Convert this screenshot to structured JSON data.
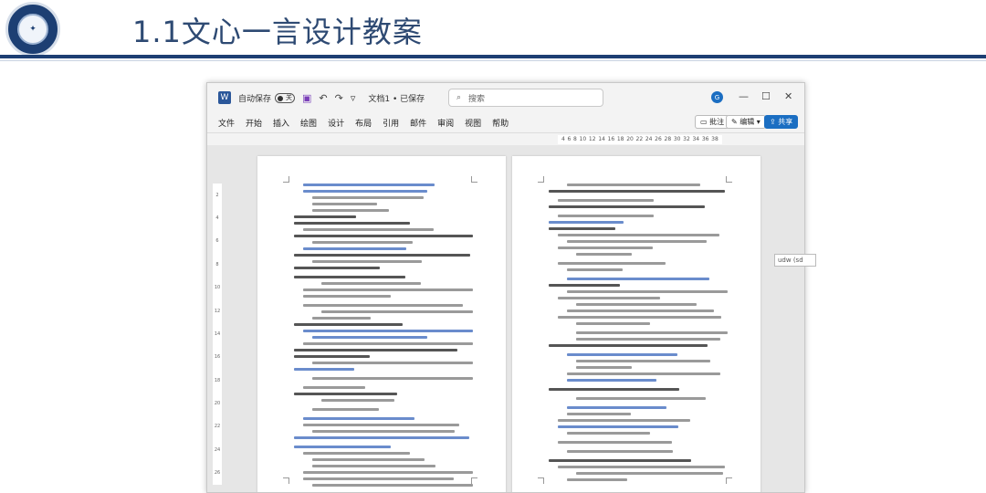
{
  "slide": {
    "title": "1.1文心一言设计教案"
  },
  "window": {
    "autosave_label": "自动保存",
    "autosave_state": "关",
    "doc_title": "文档1 • 已保存",
    "search_placeholder": "搜索",
    "avatar_initial": "G",
    "menu": [
      "文件",
      "开始",
      "插入",
      "绘图",
      "设计",
      "布局",
      "引用",
      "邮件",
      "审阅",
      "视图",
      "帮助"
    ],
    "comment_label": "批注",
    "edit_label": "编辑",
    "share_label": "共享",
    "ruler_ticks": [
      "4",
      "6",
      "8",
      "10",
      "12",
      "14",
      "16",
      "18",
      "20",
      "22",
      "24",
      "26",
      "28",
      "30",
      "32",
      "34",
      "36",
      "38"
    ],
    "vruler_ticks": [
      "2",
      "4",
      "6",
      "8",
      "10",
      "12",
      "14",
      "16",
      "18",
      "20",
      "22",
      "24",
      "26"
    ]
  },
  "tooltip_text": "udw (sd",
  "colors": {
    "rule": "#1d3f73",
    "title": "#2e4a73",
    "word_blue": "#2b579a",
    "share": "#1b6ec2"
  }
}
